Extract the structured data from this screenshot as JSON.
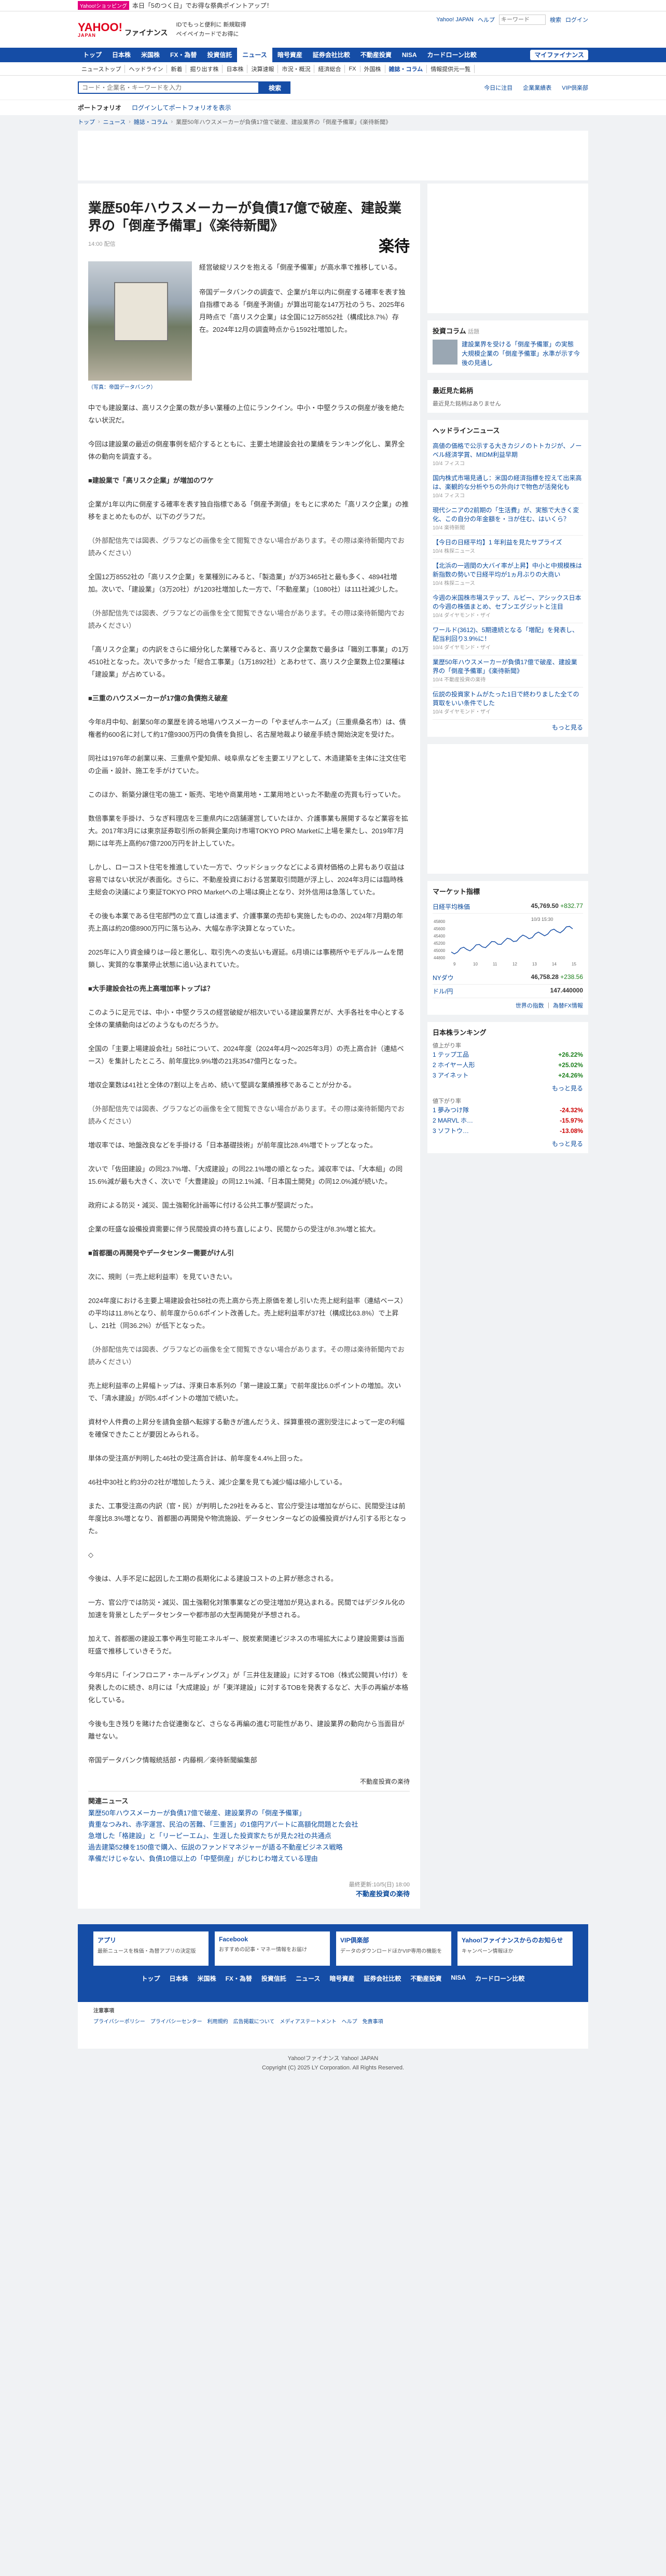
{
  "promo": {
    "badge": "Yahoo!ショッピング",
    "text": "本日「5のつく日」でお得な祭典ポイントアップ！"
  },
  "header": {
    "logo": "YAHOO!",
    "logo_sub": "JAPAN",
    "site": "ファイナンス",
    "mid1": "IDでもっと便利に 新規取得",
    "mid2": "ペイペイカードでお得に",
    "links": [
      "Yahoo! JAPAN",
      "ヘルプ"
    ],
    "search_placeholder": "キーワード",
    "search_btn": "検索",
    "login": "ログイン"
  },
  "gnav": {
    "items": [
      "トップ",
      "日本株",
      "米国株",
      "FX・為替",
      "投資信託",
      "ニュース",
      "暗号資産",
      "証券会社比較",
      "不動産投資",
      "NISA",
      "カードローン比較"
    ],
    "active": 5,
    "mypage": "マイファイナンス"
  },
  "subnav": {
    "items": [
      "ニューストップ",
      "ヘッドライン",
      "新着",
      "掘り出す株",
      "日本株",
      "決算速報",
      "市況・概況",
      "経済総合",
      "FX",
      "外国株",
      "雑誌・コラム",
      "情報提供元一覧"
    ],
    "active": 10
  },
  "search": {
    "placeholder": "コード・企業名・キーワードを入力",
    "button": "検索",
    "links": [
      "今日に注目",
      "企業業績表",
      "VIP倶楽部"
    ]
  },
  "portfolio": {
    "label": "ポートフォリオ",
    "text": "ログインしてポートフォリオを表示"
  },
  "breadcrumb": [
    "トップ",
    "ニュース",
    "雑誌・コラム",
    "業歴50年ハウスメーカーが負債17億で破産、建設業界の「倒産予備軍」《楽待新聞》"
  ],
  "article": {
    "title": "業歴50年ハウスメーカーが負債17億で破産、建設業界の「倒産予備軍」《楽待新聞》",
    "date": "14:00 配信",
    "brand": "楽待",
    "caption": "（写真：帝国データバンク）",
    "lead": "経営破綻リスクを抱える「倒産予備軍」が高水準で推移している。\n\n帝国データバンクの調査で、企業が1年以内に倒産する確率を表す独自指標である「倒産予測値」が算出可能な147万社のうち、2025年6月時点で「高リスク企業」は全国に12万8552社（構成比8.7%）存在。2024年12月の調査時点から1592社増加した。",
    "paragraphs": [
      {
        "t": "中でも建設業は、高リスク企業の数が多い業種の上位にランクイン。中小・中堅クラスの倒産が後を絶たない状況だ。",
        "c": ""
      },
      {
        "t": "今回は建設業の最近の倒産事例を紹介するとともに、主要土地建設会社の業績をランキング化し、業界全体の動向を調査する。",
        "c": ""
      },
      {
        "t": "■建設業で「高リスク企業」が増加のワケ",
        "c": "h"
      },
      {
        "t": "企業が1年以内に倒産する確率を表す独自指標である「倒産予測値」をもとに求めた「高リスク企業」の推移をまとめたものが、以下のグラフだ。",
        "c": ""
      },
      {
        "t": "（外部配信先では図表、グラフなどの画像を全て閲覧できない場合があります。その際は楽待新聞内でお読みください）",
        "c": "muted"
      },
      {
        "t": "全国12万8552社の「高リスク企業」を業種別にみると、「製造業」が3万3465社と最も多く、4894社増加。次いで、「建設業」（3万20社）が1203社増加した一方で、「不動産業」（1080社）は111社減少した。",
        "c": ""
      },
      {
        "t": "（外部配信先では図表、グラフなどの画像を全て閲覧できない場合があります。その際は楽待新聞内でお読みください）",
        "c": "muted"
      },
      {
        "t": "「高リスク企業」の内訳をさらに細分化した業種でみると、高リスク企業数で最多は「職別工事業」の1万4510社となった。次いで多かった「総合工事業」（1万1892社）とあわせて、高リスク企業数上位2業種は「建設業」が占めている。",
        "c": ""
      },
      {
        "t": "■三重のハウスメーカーが17億の負債抱え破産",
        "c": "h"
      },
      {
        "t": "今年8月中旬、創業50年の業歴を誇る地場ハウスメーカーの「やまぜんホームズ」（三重県桑名市）は、債権者約600名に対して約17億9300万円の負債を負担し、名古屋地裁より破産手続き開始決定を受けた。",
        "c": ""
      },
      {
        "t": "同社は1976年の創業以来、三重県や愛知県、岐阜県などを主要エリアとして、木造建築を主体に注文住宅の企画・設計、施工を手がけていた。",
        "c": ""
      },
      {
        "t": "このほか、新築分譲住宅の施工・販売、宅地や商業用地・工業用地といった不動産の売買も行っていた。",
        "c": ""
      },
      {
        "t": "数倍事業を手掛け、うなぎ料理店を三重県内に2店舗運営していたほか、介護事業も展開するなど業容を拡大。2017年3月には東京証券取引所の新興企業向け市場TOKYO PRO Marketに上場を果たし、2019年7月期には年売上高約67億7200万円を計上していた。",
        "c": ""
      },
      {
        "t": "しかし、ローコスト住宅を推進していた一方で、ウッドショックなどによる資材価格の上昇もあり収益は容易ではない状況が表面化。さらに、不動産投資における営業取引問題が浮上し、2024年3月には臨時株主総会の決議により東証TOKYO PRO Marketへの上場は廃止となり、対外信用は急落していた。",
        "c": ""
      },
      {
        "t": "その後も本業である住宅部門の立て直しは進まず、介護事業の売却も実施したものの、2024年7月期の年売上高は約20億8900万円に落ち込み、大幅な赤字決算となっていた。",
        "c": ""
      },
      {
        "t": "2025年に入り資金繰りは一段と悪化し、取引先への支払いも遅延。6月頃には事務所やモデルルームを閉鎖し、実質的な事業停止状態に追い込まれていた。",
        "c": ""
      },
      {
        "t": "■大手建設会社の売上高増加率トップは？",
        "c": "h"
      },
      {
        "t": "このように足元では、中小・中堅クラスの経営破綻が相次いでいる建設業界だが、大手各社を中心とする全体の業績動向はどのようなものだろうか。",
        "c": ""
      },
      {
        "t": "全国の「主要上場建設会社」58社について、2024年度（2024年4月〜2025年3月）の売上高合計（連結ベース）を集計したところ、前年度比9.9%増の21兆3547億円となった。",
        "c": ""
      },
      {
        "t": "増収企業数は41社と全体の7割以上を占め、続いて堅調な業績推移であることが分かる。",
        "c": ""
      },
      {
        "t": "（外部配信先では図表、グラフなどの画像を全て閲覧できない場合があります。その際は楽待新聞内でお読みください）",
        "c": "muted"
      },
      {
        "t": "増収率では、地盤改良などを手掛ける「日本基礎技術」が前年度比28.4%増でトップとなった。",
        "c": ""
      },
      {
        "t": "次いで「佐田建設」の同23.7%増、「大成建設」の同22.1%増の順となった。減収率では、「大本組」の同15.6%減が最も大きく、次いで「大豊建設」の同12.1%減、「日本国土開発」の同12.0%減が続いた。",
        "c": ""
      },
      {
        "t": "政府による防災・減災、国土強靭化計画等に付ける公共工事が堅調だった。",
        "c": ""
      },
      {
        "t": "企業の旺盛な設備投資需要に伴う民間投資の持ち直しにより、民間からの受注が8.3%増と拡大。",
        "c": ""
      },
      {
        "t": "■首都圏の再開発やデータセンター需要がけん引",
        "c": "h"
      },
      {
        "t": "次に、規則（＝売上総利益率）を見ていきたい。",
        "c": ""
      },
      {
        "t": "2024年度における主要上場建設会社58社の売上高から売上原価を差し引いた売上総利益率（連結ベース）の平均は11.8%となり、前年度から0.6ポイント改善した。売上総利益率が37社（構成比63.8%）で上昇し、21社（同36.2%）が低下となった。",
        "c": ""
      },
      {
        "t": "（外部配信先では図表、グラフなどの画像を全て閲覧できない場合があります。その際は楽待新聞内でお読みください）",
        "c": "muted"
      },
      {
        "t": "売上総利益率の上昇幅トップは、浮東日本系列の「第一建設工業」で前年度比6.0ポイントの増加。次いで、「清水建設」が同5.4ポイントの増加で続いた。",
        "c": ""
      },
      {
        "t": "資材や人件費の上昇分を請負金額へ転嫁する動きが進んだうえ、採算重視の選別受注によって一定の利幅を確保できたことが要因とみられる。",
        "c": ""
      },
      {
        "t": "単体の受注高が判明した46社の受注高合計は、前年度を4.4%上回った。",
        "c": ""
      },
      {
        "t": "46社中30社と約3分の2社が増加したうえ、減少企業を見ても減少幅は縮小している。",
        "c": ""
      },
      {
        "t": "また、工事受注高の内訳（官・民）が判明した29社をみると、官公庁受注は増加ながらに、民間受注は前年度比8.3%増となり、首都圏の再開発や物流施設、データセンターなどの設備投資がけん引する形となった。",
        "c": ""
      },
      {
        "t": "◇",
        "c": ""
      },
      {
        "t": "今後は、人手不足に起因した工期の長期化による建設コストの上昇が懸念される。",
        "c": ""
      },
      {
        "t": "一方、官公庁では防災・減災、国土強靭化対策事業などの受注増加が見込まれる。民間ではデジタル化の加速を背景としたデータセンターや都市部の大型再開発が予想される。",
        "c": ""
      },
      {
        "t": "加えて、首都圏の建設工事や再生可能エネルギー、脱炭素関連ビジネスの市場拡大により建設需要は当面旺盛で推移していきそうだ。",
        "c": ""
      },
      {
        "t": "今年5月に「インフロニア・ホールディングス」が「三井住友建設」に対するTOB（株式公開買い付け）を発表したのに続き、8月には「大成建設」が「東洋建設」に対するTOBを発表するなど、大手の再編が本格化している。",
        "c": ""
      },
      {
        "t": "今後も生き残りを賭けた合従連衡など、さらなる再編の進む可能性があり、建設業界の動向から当面目が離せない。",
        "c": ""
      },
      {
        "t": "帝国データバンク情報統括部・内藤桐／楽待新聞編集部",
        "c": ""
      }
    ],
    "byline": "不動産投資の楽待",
    "related_title": "関連ニュース",
    "related": [
      "業歴50年ハウスメーカーが負債17億で破産、建設業界の「倒産予備軍」",
      "貴重なつみれ、赤字運営、民泊の苦難、「三重苦」の1億円アパートに高額化問題とた会社",
      "急増した「格建設」と「リーピーエム」、生涯した投資家たちが見た2社の共通点",
      "過去建築52棟を150億で購入、伝説のファンドマネジャーが語る不動産ビジネス戦略",
      "準備だけじゃない、負債10億以上の「中堅倒産」がじわじわ増えている理由"
    ],
    "foot_date": "最終更新:10/5(日) 18:00",
    "foot_source": "不動産投資の楽待"
  },
  "side": {
    "pickup_title": "投資コラム",
    "pickup_tab": "話題",
    "pickups": [
      {
        "t": "建設業界を受ける「倒産予備軍」の実態"
      },
      {
        "t": "大規模企業の「倒産予備軍」水準が示す今後の見通し"
      }
    ],
    "ad_title": "最近見た銘柄",
    "ad_text": "最近見た銘柄はありません",
    "headline_title": "ヘッドラインニュース",
    "headlines": [
      {
        "t": "高値の価格で公示する大きカジノのトトカジが、ノーベル経済学賞、MIDM利益早期",
        "s": "10/4 フィスコ"
      },
      {
        "t": "国内株式市場見通し：米国の経済指標を控えて出来高は、楽観的な分析やちの外向けで物色が活発化も",
        "s": "10/4 フィスコ"
      },
      {
        "t": "現代シニアの2前期の「生活費」が、実態で大きく変化、この自分の年金額を・ヨが住む、はいくら？",
        "s": "10/4 楽待新聞"
      },
      {
        "t": "【今日の日経平均】1 年利益を見たサプライズ",
        "s": "10/4 株探ニュース"
      },
      {
        "t": "【北浜の一週間の大バイ率が上昇】中小と中規模株は新指数の勢いで日経平均が1ヵ月ぶりの大商い",
        "s": "10/4 株探ニュース"
      },
      {
        "t": "今週の米国株市場ステップ、ルビー、アシックス日本の今週の株価まとめ、セブンエグジットと注目",
        "s": "10/4 ダイヤモンド・ザイ"
      },
      {
        "t": "ワールド(3612)、5期連続となる「増配」を発表し、配当利回り3.9%に！",
        "s": "10/4 ダイヤモンド・ザイ"
      },
      {
        "t": "業歴50年ハウスメーカーが負債17億で破産、建設業界の「倒産予備軍」《楽待新聞》",
        "s": "10/4 不動産投資の楽待"
      },
      {
        "t": "伝説の投資家トムがたった1日で終わりました全ての買取をいい条件でした",
        "s": "10/4 ダイヤモンド・ザイ"
      }
    ],
    "more": "もっと見る",
    "market_title": "マーケット指標",
    "market": [
      {
        "name": "日経平均株価",
        "val": "45,769.50",
        "chg": "+832.77"
      },
      {
        "name": "NYダウ",
        "val": "46,758.28",
        "chg": "+238.56"
      },
      {
        "name": "ドル/円",
        "val": "147.440000",
        "chg": ""
      }
    ],
    "chart_label": "10/3 15:30",
    "chart_ticks": [
      "9",
      "10",
      "11",
      "12",
      "13",
      "14",
      "15"
    ],
    "chart_y": [
      "45800",
      "45600",
      "45400",
      "45200",
      "45000",
      "44800"
    ],
    "chart_links": [
      "世界の指数",
      "為替FX情報"
    ],
    "rank_title": "日本株ランキング",
    "rank_up_label": "値上がり率",
    "rank_up": [
      {
        "n": "1 テップ工品",
        "v": "+26.22%"
      },
      {
        "n": "2 ホイヤー人形",
        "v": "+25.02%"
      },
      {
        "n": "3 アイネット",
        "v": "+24.26%"
      }
    ],
    "rank_down_label": "値下がり率",
    "rank_down": [
      {
        "n": "1 夢みつけ隊",
        "v": "-24.32%"
      },
      {
        "n": "2 MARVL ホ…",
        "v": "-15.97%"
      },
      {
        "n": "3 ソフトウ…",
        "v": "-13.08%"
      }
    ]
  },
  "footer": {
    "cards": [
      {
        "t": "アプリ",
        "s": "最新ニュースを株価・為替アプリの決定版"
      },
      {
        "t": "Facebook",
        "s": "おすすめの記事・マネー情報をお届け"
      },
      {
        "t": "VIP倶楽部",
        "s": "データのダウンロードほかVIP専用の機能を"
      },
      {
        "t": "Yahoo!ファイナンスからのお知らせ",
        "s": "キャンペーン情報ほか"
      }
    ],
    "nav": [
      "トップ",
      "日本株",
      "米国株",
      "FX・為替",
      "投資信託",
      "ニュース",
      "暗号資産",
      "証券会社比較",
      "不動産投資",
      "NISA",
      "カードローン比較"
    ],
    "note_title": "注意事項",
    "links": [
      "プライバシーポリシー",
      "プライバシーセンター",
      "利用規約",
      "広告掲載について",
      "メディアステートメント",
      "ヘルプ",
      "免責事項"
    ],
    "company": "Yahoo!ファイナンス  Yahoo! JAPAN",
    "copyright": "Copyright (C) 2025 LY Corporation. All Rights Reserved."
  }
}
